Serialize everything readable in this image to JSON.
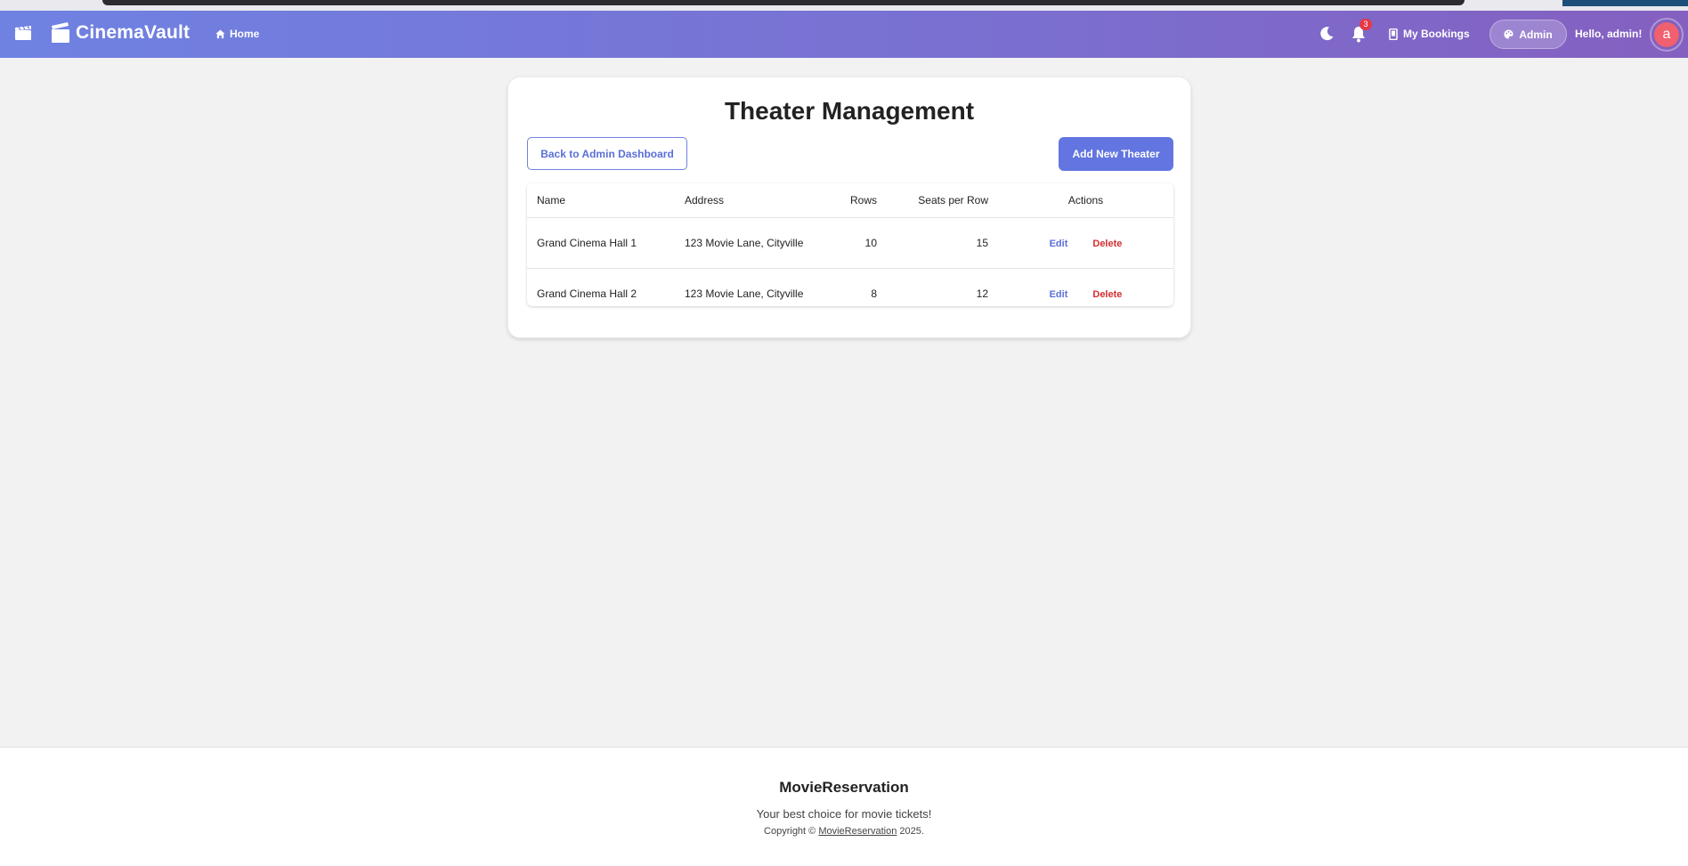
{
  "nav": {
    "brand": "CinemaVault",
    "home_label": "Home",
    "notification_count": "3",
    "bookings_label": "My Bookings",
    "admin_label": "Admin",
    "greeting": "Hello, admin!",
    "avatar_letter": "a"
  },
  "page": {
    "title": "Theater Management",
    "back_label": "Back to Admin Dashboard",
    "add_label": "Add New Theater"
  },
  "table": {
    "headers": {
      "name": "Name",
      "address": "Address",
      "rows": "Rows",
      "seats": "Seats per Row",
      "actions": "Actions"
    },
    "rows": [
      {
        "name": "Grand Cinema Hall 1",
        "address": "123 Movie Lane, Cityville",
        "rows": "10",
        "seats": "15",
        "edit": "Edit",
        "delete": "Delete"
      },
      {
        "name": "Grand Cinema Hall 2",
        "address": "123 Movie Lane, Cityville",
        "rows": "8",
        "seats": "12",
        "edit": "Edit",
        "delete": "Delete"
      }
    ]
  },
  "footer": {
    "title": "MovieReservation",
    "tagline": "Your best choice for movie tickets!",
    "copyright_prefix": "Copyright © ",
    "copyright_link": "MovieReservation",
    "copyright_suffix": " 2025."
  },
  "colors": {
    "accent": "#6275e0",
    "danger": "#d32f2f",
    "badge": "#e53946",
    "avatar": "#f0606e"
  }
}
